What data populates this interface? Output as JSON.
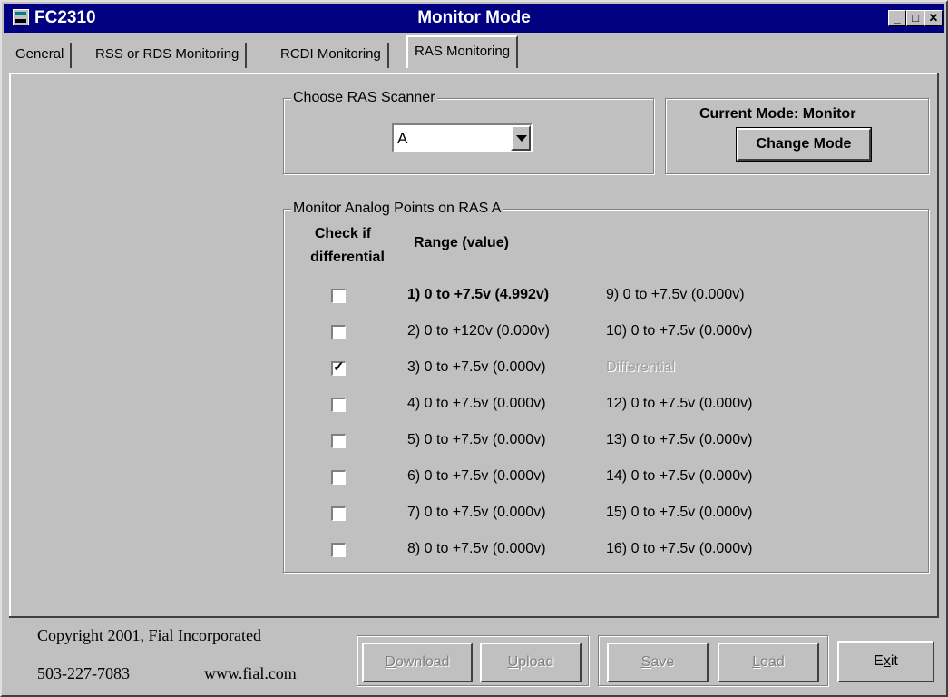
{
  "window": {
    "app_name": "FC2310",
    "title": "Monitor Mode"
  },
  "controls": {
    "minimize": "_",
    "maximize": "□",
    "close": "✕"
  },
  "tabs": [
    {
      "label": "General"
    },
    {
      "label": "RSS or RDS Monitoring"
    },
    {
      "label": "RCDI  Monitoring"
    },
    {
      "label": "RAS Monitoring",
      "active": true
    }
  ],
  "scanner": {
    "legend": "Choose RAS Scanner",
    "value": "A"
  },
  "mode": {
    "label": "Current Mode: Monitor",
    "button": "Change Mode"
  },
  "points": {
    "legend": "Monitor Analog Points on RAS A",
    "hdr_check_1": "Check if",
    "hdr_check_2": "differential",
    "hdr_range": "Range (value)",
    "rows": [
      {
        "checked": false,
        "left": "1)  0 to +7.5v (4.992v)",
        "right": "9)  0 to +7.5v (0.000v)",
        "left_bold": true,
        "right_disabled": false
      },
      {
        "checked": false,
        "left": "2)  0 to +120v (0.000v)",
        "right": "10)  0 to +7.5v (0.000v)",
        "left_bold": false,
        "right_disabled": false
      },
      {
        "checked": true,
        "left": "3)  0 to +7.5v (0.000v)",
        "right": "Differential",
        "left_bold": false,
        "right_disabled": true
      },
      {
        "checked": false,
        "left": "4)  0 to +7.5v (0.000v)",
        "right": "12)  0 to +7.5v (0.000v)",
        "left_bold": false,
        "right_disabled": false
      },
      {
        "checked": false,
        "left": "5)  0 to +7.5v (0.000v)",
        "right": "13)  0 to +7.5v (0.000v)",
        "left_bold": false,
        "right_disabled": false
      },
      {
        "checked": false,
        "left": "6)  0 to +7.5v (0.000v)",
        "right": "14)  0 to +7.5v (0.000v)",
        "left_bold": false,
        "right_disabled": false
      },
      {
        "checked": false,
        "left": "7)  0 to +7.5v (0.000v)",
        "right": "15)  0 to +7.5v (0.000v)",
        "left_bold": false,
        "right_disabled": false
      },
      {
        "checked": false,
        "left": "8)  0 to +7.5v (0.000v)",
        "right": "16)  0 to +7.5v (0.000v)",
        "left_bold": false,
        "right_disabled": false
      }
    ]
  },
  "footer": {
    "copyright": "Copyright 2001, Fial Incorporated",
    "phone": "503-227-7083",
    "website": "www.fial.com",
    "download_u": "D",
    "download_rest": "ownload",
    "upload_u": "U",
    "upload_rest": "pload",
    "save_u": "S",
    "save_rest": "ave",
    "load_u": "L",
    "load_rest": "oad",
    "exit_pre": "E",
    "exit_u": "x",
    "exit_rest": "it"
  }
}
